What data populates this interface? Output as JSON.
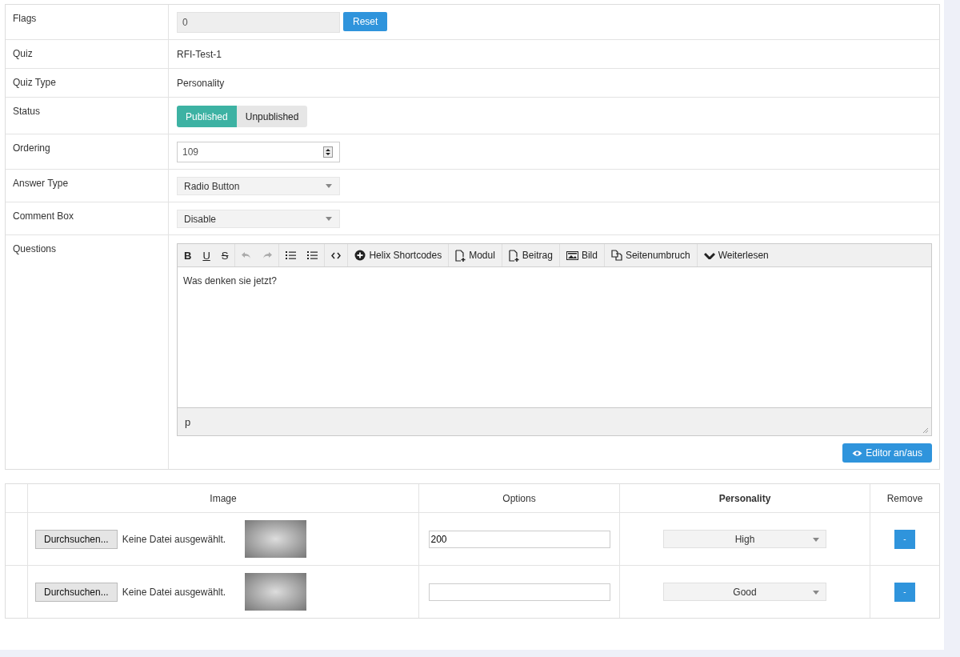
{
  "form": [
    {
      "kind": "flags",
      "label": "Flags",
      "value": "0",
      "button": "Reset"
    },
    {
      "kind": "text",
      "label": "Quiz",
      "value": "RFI-Test-1"
    },
    {
      "kind": "text",
      "label": "Quiz Type",
      "value": "Personality"
    },
    {
      "kind": "toggle",
      "label": "Status",
      "options": [
        {
          "label": "Published",
          "selected": true
        },
        {
          "label": "Unpublished",
          "selected": false
        }
      ]
    },
    {
      "kind": "number",
      "label": "Ordering",
      "value": "109"
    },
    {
      "kind": "select",
      "label": "Answer Type",
      "value": "Radio Button"
    },
    {
      "kind": "select",
      "label": "Comment Box",
      "value": "Disable"
    },
    {
      "kind": "editor",
      "label": "Questions",
      "editor": {
        "toolbar": [
          [
            {
              "kind": "bold",
              "label": "B",
              "disabled": false
            },
            {
              "kind": "underline",
              "label": "U",
              "disabled": false
            },
            {
              "kind": "strike",
              "label": "S",
              "disabled": false
            }
          ],
          [
            {
              "kind": "undo",
              "disabled": true
            },
            {
              "kind": "redo",
              "disabled": true
            }
          ],
          [
            {
              "kind": "bullets",
              "disabled": false
            },
            {
              "kind": "numbers",
              "disabled": false
            }
          ],
          [
            {
              "kind": "code",
              "disabled": false
            }
          ],
          [
            {
              "kind": "circle",
              "label": "Helix Shortcodes",
              "disabled": false
            }
          ],
          [
            {
              "kind": "page",
              "label": "Modul",
              "disabled": false
            }
          ],
          [
            {
              "kind": "page",
              "label": "Beitrag",
              "disabled": false
            }
          ],
          [
            {
              "kind": "picture",
              "label": "Bild",
              "disabled": false
            }
          ],
          [
            {
              "kind": "pages",
              "label": "Seitenumbruch",
              "disabled": false
            }
          ],
          [
            {
              "kind": "chevron",
              "label": "Weiterlesen",
              "disabled": false
            }
          ]
        ],
        "content": "Was denken sie jetzt?",
        "path": "p",
        "toggle_button": "Editor an/aus"
      }
    }
  ],
  "options_table": {
    "columns": [
      {
        "label": "Image",
        "bold": false
      },
      {
        "label": "Options",
        "bold": false
      },
      {
        "label": "Personality",
        "bold": true
      },
      {
        "label": "Remove",
        "bold": false
      }
    ],
    "rows": [
      {
        "browse": "Durchsuchen...",
        "file": "Keine Datei ausgewählt.",
        "option": "200",
        "personality": "High",
        "remove": "-"
      },
      {
        "browse": "Durchsuchen...",
        "file": "Keine Datei ausgewählt.",
        "option": "",
        "personality": "Good",
        "remove": "-"
      }
    ]
  }
}
